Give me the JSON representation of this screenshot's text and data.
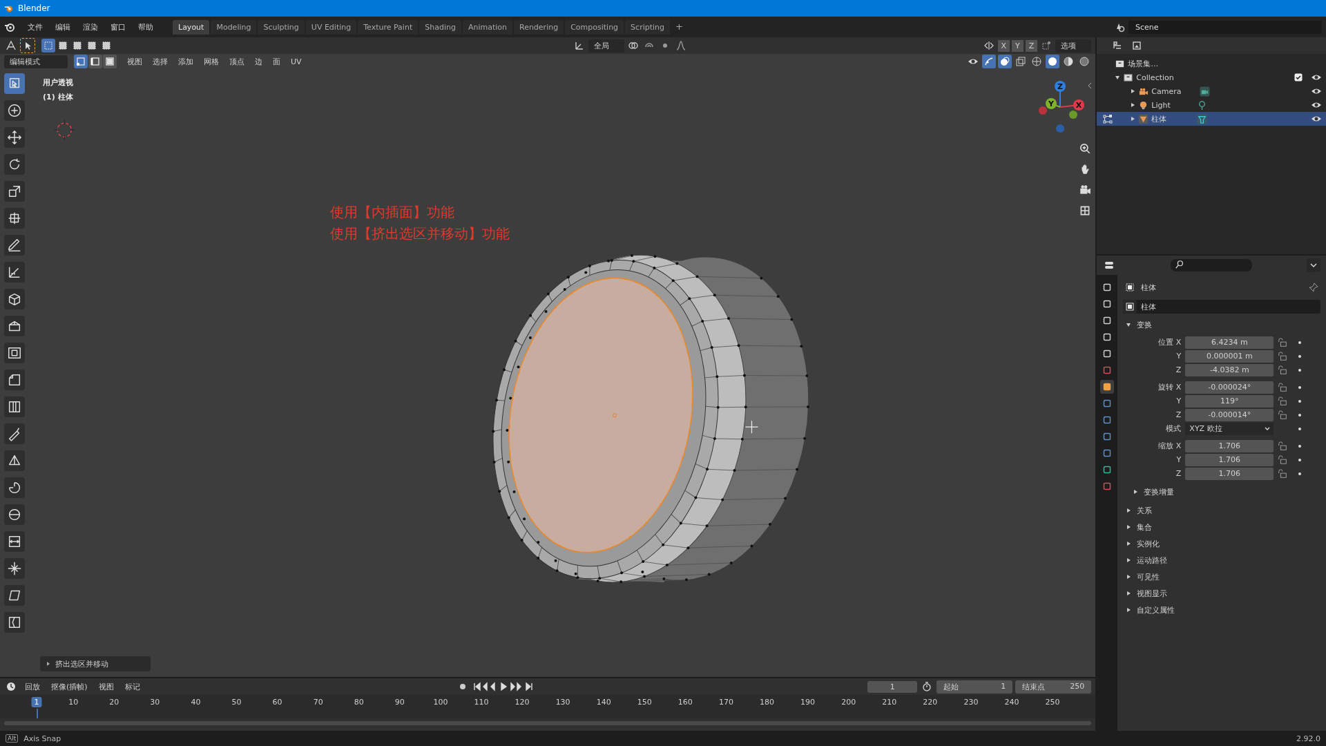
{
  "window": {
    "title": "Blender"
  },
  "menu": [
    "文件",
    "编辑",
    "渲染",
    "窗口",
    "帮助"
  ],
  "workspace_tabs": [
    {
      "label": "Layout",
      "selected": true
    },
    {
      "label": "Modeling",
      "selected": false
    },
    {
      "label": "Sculpting",
      "selected": false
    },
    {
      "label": "UV Editing",
      "selected": false
    },
    {
      "label": "Texture Paint",
      "selected": false
    },
    {
      "label": "Shading",
      "selected": false
    },
    {
      "label": "Animation",
      "selected": false
    },
    {
      "label": "Rendering",
      "selected": false
    },
    {
      "label": "Compositing",
      "selected": false
    },
    {
      "label": "Scripting",
      "selected": false
    }
  ],
  "add_tab": "+",
  "scene": "Scene",
  "viewport": {
    "orientation": "全局",
    "axis_buttons": [
      "X",
      "Y",
      "Z"
    ],
    "options": "选项",
    "mode": "编辑模式",
    "select_modes": [
      {
        "kind": "vertex",
        "selected": true
      },
      {
        "kind": "edge",
        "selected": false
      },
      {
        "kind": "face",
        "selected": false
      }
    ],
    "menus": [
      "视图",
      "选择",
      "添加",
      "网格",
      "顶点",
      "边",
      "面",
      "UV"
    ],
    "view_name": "用户透视",
    "object_label": "(1) 柱体",
    "annotations": [
      "使用【内插面】功能",
      "使用【挤出选区并移动】功能"
    ],
    "gizmo": [
      {
        "label": "Z",
        "color": "#2f7fe0"
      },
      {
        "label": "X",
        "color": "#e0394a"
      },
      {
        "label": "Y",
        "color": "#7fb32a"
      }
    ],
    "last_operator": "挤出选区并移动",
    "tools": [
      {
        "kind": "select",
        "selected": true
      },
      {
        "kind": "cursor",
        "selected": false
      },
      {
        "kind": "move",
        "selected": false
      },
      {
        "kind": "rotate",
        "selected": false
      },
      {
        "kind": "scale",
        "selected": false
      },
      {
        "kind": "transform",
        "selected": false
      },
      {
        "kind": "annotate",
        "selected": false
      },
      {
        "kind": "measure",
        "selected": false
      },
      {
        "kind": "cube",
        "selected": false
      },
      {
        "kind": "extrude",
        "selected": false
      },
      {
        "kind": "inset",
        "selected": false
      },
      {
        "kind": "bevel",
        "selected": false
      },
      {
        "kind": "loopcut",
        "selected": false
      },
      {
        "kind": "knife",
        "selected": false
      },
      {
        "kind": "polybuild",
        "selected": false
      },
      {
        "kind": "spin",
        "selected": false
      },
      {
        "kind": "smooth",
        "selected": false
      },
      {
        "kind": "slide",
        "selected": false
      },
      {
        "kind": "shrink",
        "selected": false
      },
      {
        "kind": "shear",
        "selected": false
      },
      {
        "kind": "rip",
        "selected": false
      }
    ]
  },
  "outliner": {
    "root": "场景集…",
    "items": [
      {
        "label": "Collection",
        "expanded": true,
        "checked": true,
        "children": [
          {
            "label": "Camera",
            "kind": "camera",
            "selected": false
          },
          {
            "label": "Light",
            "kind": "light",
            "selected": false
          },
          {
            "label": "柱体",
            "kind": "mesh",
            "selected": true
          }
        ]
      }
    ]
  },
  "properties": {
    "tabs": [
      {
        "kind": "tool",
        "selected": false
      },
      {
        "kind": "render",
        "selected": false
      },
      {
        "kind": "output",
        "selected": false
      },
      {
        "kind": "viewlayer",
        "selected": false
      },
      {
        "kind": "scene",
        "selected": false
      },
      {
        "kind": "world",
        "selected": false
      },
      {
        "kind": "object",
        "selected": true
      },
      {
        "kind": "modifier",
        "selected": false
      },
      {
        "kind": "particles",
        "selected": false
      },
      {
        "kind": "physics",
        "selected": false
      },
      {
        "kind": "constraints",
        "selected": false
      },
      {
        "kind": "data",
        "selected": false
      },
      {
        "kind": "material",
        "selected": false
      }
    ],
    "object_name": "柱体",
    "datablock": "柱体",
    "transform": {
      "label": "变换",
      "expanded": true,
      "groups": [
        [
          {
            "kind": "number",
            "label": "位置 X",
            "value": "6.4234 m"
          },
          {
            "kind": "number",
            "label": "Y",
            "value": "0.000001 m"
          },
          {
            "kind": "number",
            "label": "Z",
            "value": "-4.0382 m"
          }
        ],
        [
          {
            "kind": "number",
            "label": "旋转 X",
            "value": "-0.000024°"
          },
          {
            "kind": "number",
            "label": "Y",
            "value": "119°"
          },
          {
            "kind": "number",
            "label": "Z",
            "value": "-0.000014°"
          },
          {
            "kind": "dropdown",
            "label": "模式",
            "value": "XYZ 欧拉"
          }
        ],
        [
          {
            "kind": "number",
            "label": "缩放 X",
            "value": "1.706"
          },
          {
            "kind": "number",
            "label": "Y",
            "value": "1.706"
          },
          {
            "kind": "number",
            "label": "Z",
            "value": "1.706"
          }
        ]
      ],
      "subpanel": {
        "label": "变换增量",
        "expanded": false
      }
    },
    "panels": [
      {
        "label": "关系",
        "expanded": false
      },
      {
        "label": "集合",
        "expanded": false
      },
      {
        "label": "实例化",
        "expanded": false
      },
      {
        "label": "运动路径",
        "expanded": false
      },
      {
        "label": "可见性",
        "expanded": false
      },
      {
        "label": "视图显示",
        "expanded": false
      },
      {
        "label": "自定义属性",
        "expanded": false
      }
    ]
  },
  "timeline": {
    "menus": [
      "回放",
      "抠像(插帧)",
      "视图",
      "标记"
    ],
    "current_frame": "1",
    "start_label": "起始",
    "start": "1",
    "end_label": "结束点",
    "end": "250",
    "ruler": [
      {
        "label": "1",
        "selected": true
      },
      {
        "label": "10",
        "selected": false
      },
      {
        "label": "20",
        "selected": false
      },
      {
        "label": "30",
        "selected": false
      },
      {
        "label": "40",
        "selected": false
      },
      {
        "label": "50",
        "selected": false
      },
      {
        "label": "60",
        "selected": false
      },
      {
        "label": "70",
        "selected": false
      },
      {
        "label": "80",
        "selected": false
      },
      {
        "label": "90",
        "selected": false
      },
      {
        "label": "100",
        "selected": false
      },
      {
        "label": "110",
        "selected": false
      },
      {
        "label": "120",
        "selected": false
      },
      {
        "label": "130",
        "selected": false
      },
      {
        "label": "140",
        "selected": false
      },
      {
        "label": "150",
        "selected": false
      },
      {
        "label": "160",
        "selected": false
      },
      {
        "label": "170",
        "selected": false
      },
      {
        "label": "180",
        "selected": false
      },
      {
        "label": "190",
        "selected": false
      },
      {
        "label": "200",
        "selected": false
      },
      {
        "label": "210",
        "selected": false
      },
      {
        "label": "220",
        "selected": false
      },
      {
        "label": "230",
        "selected": false
      },
      {
        "label": "240",
        "selected": false
      },
      {
        "label": "250",
        "selected": false
      }
    ]
  },
  "status_bar": {
    "key": "Alt",
    "hint": "Axis Snap",
    "version": "2.92.0"
  }
}
